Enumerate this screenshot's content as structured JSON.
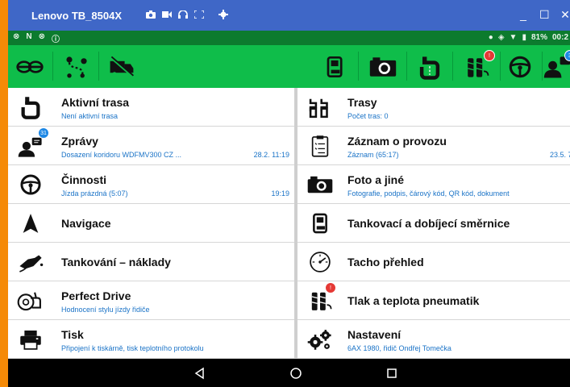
{
  "window": {
    "title": "Lenovo TB_8504X",
    "titlebar_icons": [
      "camera-icon",
      "video-icon",
      "headphones-icon",
      "fullscreen-icon",
      "settings-icon"
    ],
    "controls": [
      "minimize-icon",
      "maximize-icon",
      "close-icon"
    ]
  },
  "statusbar": {
    "left_icons": [
      "rcs-icon",
      "nfc-icon",
      "rcs-icon",
      "info-icon"
    ],
    "battery": "81%",
    "time": "00:2"
  },
  "toolbar": {
    "left": [
      "route-connect-icon",
      "route-waypoints-icon",
      "truck-off-icon"
    ],
    "right": [
      "fuel-pump-icon",
      "camera-icon",
      "route-icon",
      "tire-icon",
      "steering-wheel-icon",
      "messages-icon"
    ],
    "tire_badge": "!",
    "messages_badge": "3"
  },
  "colors": {
    "accent": "#0fbd4a",
    "accent_dark": "#0c7b2e",
    "title_blue": "#3f67c7",
    "link_blue": "#1a73c7",
    "frame_orange": "#f58a07"
  },
  "menu_left": [
    {
      "label": "Aktivní trasa",
      "sub": "Není aktivní trasa",
      "time": "",
      "icon": "route-icon"
    },
    {
      "label": "Zprávy",
      "sub": "Dosazení koridoru WDFMV300 CZ ...",
      "time": "28.2. 11:19",
      "icon": "messages-icon",
      "badge": "31"
    },
    {
      "label": "Činnosti",
      "sub": "Jízda prázdná (5:07)",
      "time": "19:19",
      "icon": "steering-wheel-icon"
    },
    {
      "label": "Navigace",
      "sub": "",
      "time": "",
      "icon": "navigation-arrow-icon"
    },
    {
      "label": "Tankování – náklady",
      "sub": "",
      "time": "",
      "icon": "fuel-nozzle-icon"
    },
    {
      "label": "Perfect Drive",
      "sub": "Hodnocení stylu jízdy řidiče",
      "time": "",
      "icon": "perfect-drive-icon"
    },
    {
      "label": "Tisk",
      "sub": "Připojení k tiskárně, tisk teplotního protokolu",
      "time": "",
      "icon": "printer-icon"
    }
  ],
  "menu_right": [
    {
      "label": "Trasy",
      "sub": "Počet tras: 0",
      "time": "",
      "icon": "routes-icon"
    },
    {
      "label": "Záznam o provozu",
      "sub": "Záznam (65:17)",
      "time": "23.5. 7:0",
      "icon": "clipboard-icon"
    },
    {
      "label": "Foto a jiné",
      "sub": "Fotografie, podpis, čárový kód, QR kód, dokument",
      "time": "",
      "icon": "camera-icon"
    },
    {
      "label": "Tankovací a dobíjecí směrnice",
      "sub": "",
      "time": "",
      "icon": "fuel-pump-icon"
    },
    {
      "label": "Tacho přehled",
      "sub": "",
      "time": "",
      "icon": "tachometer-icon"
    },
    {
      "label": "Tlak a teplota pneumatik",
      "sub": "",
      "time": "",
      "icon": "tire-icon",
      "badge": "!"
    },
    {
      "label": "Nastavení",
      "sub": "6AX 1980, řidič Ondřej Tomečka",
      "time": "",
      "icon": "gears-icon"
    }
  ],
  "navbar": {
    "buttons": [
      "back-icon",
      "home-icon",
      "recents-icon"
    ]
  }
}
